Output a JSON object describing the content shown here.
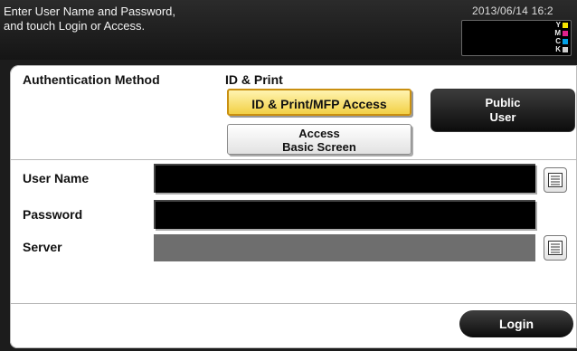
{
  "header": {
    "message": "Enter User Name and Password,\nand touch Login or Access.",
    "datetime": "2013/06/14 16:2"
  },
  "toner": [
    {
      "label": "Y",
      "color": "#f5e400"
    },
    {
      "label": "M",
      "color": "#e0218a"
    },
    {
      "label": "C",
      "color": "#00a0e6"
    },
    {
      "label": "K",
      "color": "#cccccc"
    }
  ],
  "auth": {
    "method_label": "Authentication Method",
    "method_value": "ID & Print",
    "id_print_button": "ID & Print/MFP Access",
    "access_basic_button": "Access\nBasic Screen",
    "public_user_button": "Public\nUser"
  },
  "form": {
    "user_name_label": "User Name",
    "user_name_value": "",
    "password_label": "Password",
    "password_value": "",
    "server_label": "Server",
    "server_value": ""
  },
  "footer": {
    "login_button": "Login"
  },
  "icons": {
    "keyboard": "keyboard-icon"
  }
}
